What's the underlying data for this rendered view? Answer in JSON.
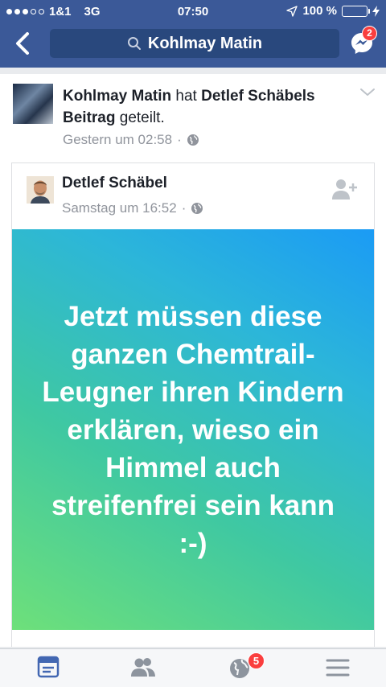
{
  "status_bar": {
    "carrier": "1&1",
    "network": "3G",
    "time": "07:50",
    "battery": "100 %",
    "battery_level": 1.0,
    "signal_bars": 3
  },
  "nav": {
    "search_query": "Kohlmay Matin",
    "messenger_badge": "2"
  },
  "share": {
    "sharer_name": "Kohlmay Matin",
    "verb": "hat",
    "original_author_possessive": "Detlef Schäbels",
    "object": "Beitrag",
    "action": "geteilt.",
    "time": "Gestern um 02:58"
  },
  "post": {
    "author": "Detlef Schäbel",
    "time": "Samstag um 16:52",
    "text": "Jetzt müssen diese ganzen Chemtrail-Leugner ihren Kindern erklären, wieso ein Himmel auch streifenfrei sein kann :-)"
  },
  "tabbar": {
    "notifications_badge": "5",
    "active": "news-feed"
  },
  "colors": {
    "brand": "#3b5998",
    "badge": "#fa3e3e",
    "active_tab": "#4267b2",
    "inactive_tab": "#8d949e"
  }
}
